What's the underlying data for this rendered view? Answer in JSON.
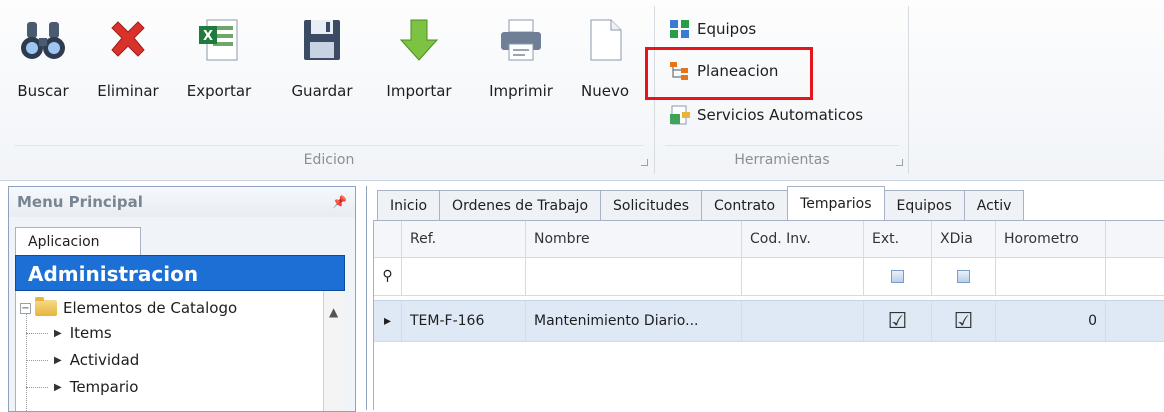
{
  "ribbon": {
    "edicion": {
      "label": "Edicion",
      "buttons": [
        {
          "id": "buscar",
          "label": "Buscar",
          "icon": "binoculars-icon"
        },
        {
          "id": "eliminar",
          "label": "Eliminar",
          "icon": "delete-x-icon"
        },
        {
          "id": "exportar",
          "label": "Exportar",
          "icon": "excel-icon"
        },
        {
          "id": "guardar",
          "label": "Guardar",
          "icon": "floppy-disk-icon"
        },
        {
          "id": "importar",
          "label": "Importar",
          "icon": "down-arrow-icon"
        },
        {
          "id": "imprimir",
          "label": "Imprimir",
          "icon": "printer-icon"
        },
        {
          "id": "nuevo",
          "label": "Nuevo",
          "icon": "blank-document-icon"
        }
      ]
    },
    "herramientas": {
      "label": "Herramientas",
      "items": [
        {
          "id": "equipos",
          "label": "Equipos",
          "icon": "equipment-icon"
        },
        {
          "id": "planeacion",
          "label": "Planeacion",
          "icon": "planning-tree-icon",
          "highlight_color": "#e8141a"
        },
        {
          "id": "servicios",
          "label": "Servicios Automaticos",
          "icon": "services-icon"
        }
      ]
    }
  },
  "menu": {
    "title": "Menu Principal",
    "tab": "Aplicacion",
    "section": "Administracion",
    "tree": {
      "root": "Elementos de Catalogo",
      "children": [
        "Items",
        "Actividad",
        "Tempario"
      ]
    }
  },
  "tabs": [
    "Inicio",
    "Ordenes de Trabajo",
    "Solicitudes",
    "Contrato",
    "Temparios",
    "Equipos",
    "Activ"
  ],
  "active_tab": "Temparios",
  "grid": {
    "columns": [
      "Ref.",
      "Nombre",
      "Cod. Inv.",
      "Ext.",
      "XDia",
      "Horometro"
    ],
    "rows": [
      {
        "ref": "TEM-F-166",
        "nombre": "Mantenimiento Diario...",
        "cod_inv": "",
        "ext": true,
        "xdia": true,
        "horometro": "0"
      }
    ]
  },
  "colors": {
    "accent": "#1c6fd5",
    "highlight": "#e8141a",
    "selected_row": "#dfe9f6"
  }
}
